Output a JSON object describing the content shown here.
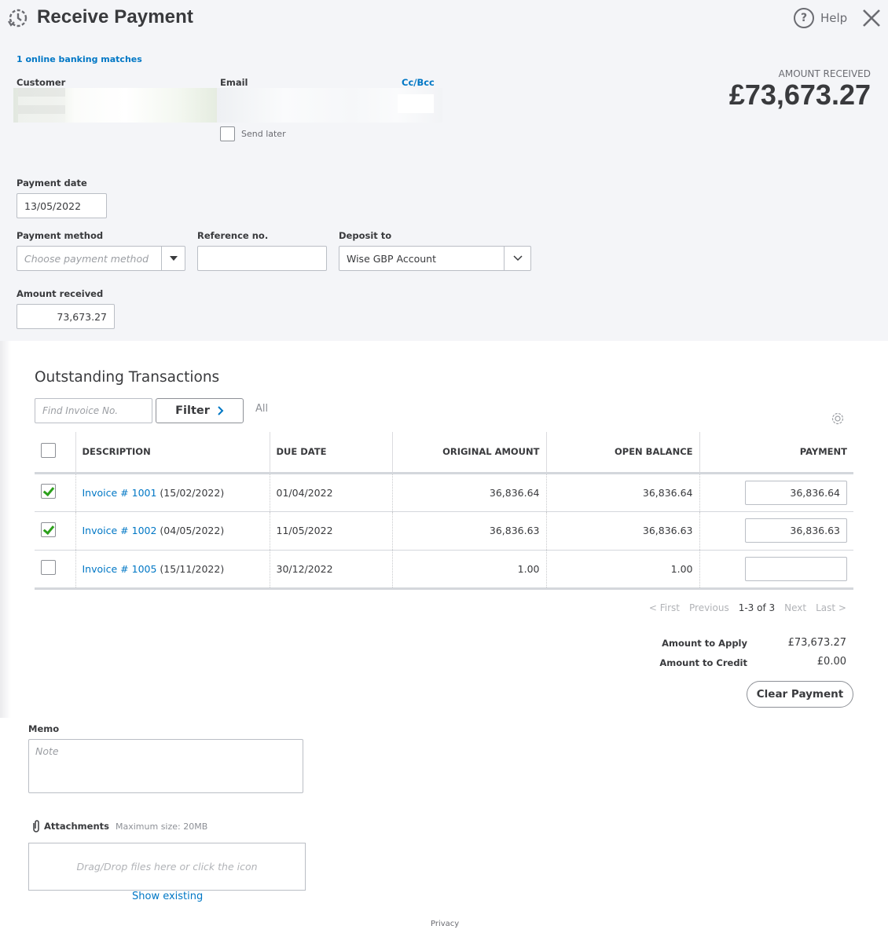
{
  "header": {
    "title": "Receive Payment",
    "help_label": "Help",
    "icons": {
      "history": "history-clock-icon",
      "help": "help-circle-icon",
      "close": "close-x-icon"
    }
  },
  "banking_matches": "1 online banking matches",
  "customer": {
    "label": "Customer",
    "value": ""
  },
  "email": {
    "label": "Email",
    "value": "",
    "cc_bcc": "Cc/Bcc"
  },
  "send_later": {
    "label": "Send later",
    "checked": false
  },
  "amount_received_summary": {
    "label": "AMOUNT RECEIVED",
    "value": "£73,673.27"
  },
  "payment_date": {
    "label": "Payment date",
    "value": "13/05/2022"
  },
  "payment_method": {
    "label": "Payment method",
    "placeholder": "Choose payment method",
    "value": ""
  },
  "reference_no": {
    "label": "Reference no.",
    "value": ""
  },
  "deposit_to": {
    "label": "Deposit to",
    "value": "Wise GBP Account"
  },
  "amount_received": {
    "label": "Amount received",
    "value": "73,673.27"
  },
  "outstanding": {
    "title": "Outstanding Transactions",
    "search_placeholder": "Find Invoice No.",
    "filter_label": "Filter",
    "filter_value": "All",
    "columns": [
      "DESCRIPTION",
      "DUE DATE",
      "ORIGINAL AMOUNT",
      "OPEN BALANCE",
      "PAYMENT"
    ],
    "rows": [
      {
        "checked": true,
        "invoice": "Invoice # 1001",
        "date": "(15/02/2022)",
        "due": "01/04/2022",
        "original": "36,836.64",
        "open": "36,836.64",
        "payment": "36,836.64"
      },
      {
        "checked": true,
        "invoice": "Invoice # 1002",
        "date": "(04/05/2022)",
        "due": "11/05/2022",
        "original": "36,836.63",
        "open": "36,836.63",
        "payment": "36,836.63"
      },
      {
        "checked": false,
        "invoice": "Invoice # 1005",
        "date": "(15/11/2022)",
        "due": "30/12/2022",
        "original": "1.00",
        "open": "1.00",
        "payment": ""
      }
    ],
    "pager": {
      "first": "< First",
      "previous": "Previous",
      "range": "1-3 of 3",
      "next": "Next",
      "last": "Last >"
    }
  },
  "totals": {
    "apply_label": "Amount to Apply",
    "apply_value": "£73,673.27",
    "credit_label": "Amount to Credit",
    "credit_value": "£0.00"
  },
  "clear_payment": "Clear Payment",
  "memo": {
    "label": "Memo",
    "placeholder": "Note"
  },
  "attachments": {
    "label": "Attachments",
    "max_size": "Maximum size: 20MB",
    "drop_text": "Drag/Drop files here or click the icon",
    "show_existing": "Show existing"
  },
  "footer": {
    "privacy": "Privacy"
  },
  "colors": {
    "link": "#0077c5",
    "check": "#2ca01c",
    "text": "#393a3d",
    "header_bg": "#f4f5f8"
  }
}
